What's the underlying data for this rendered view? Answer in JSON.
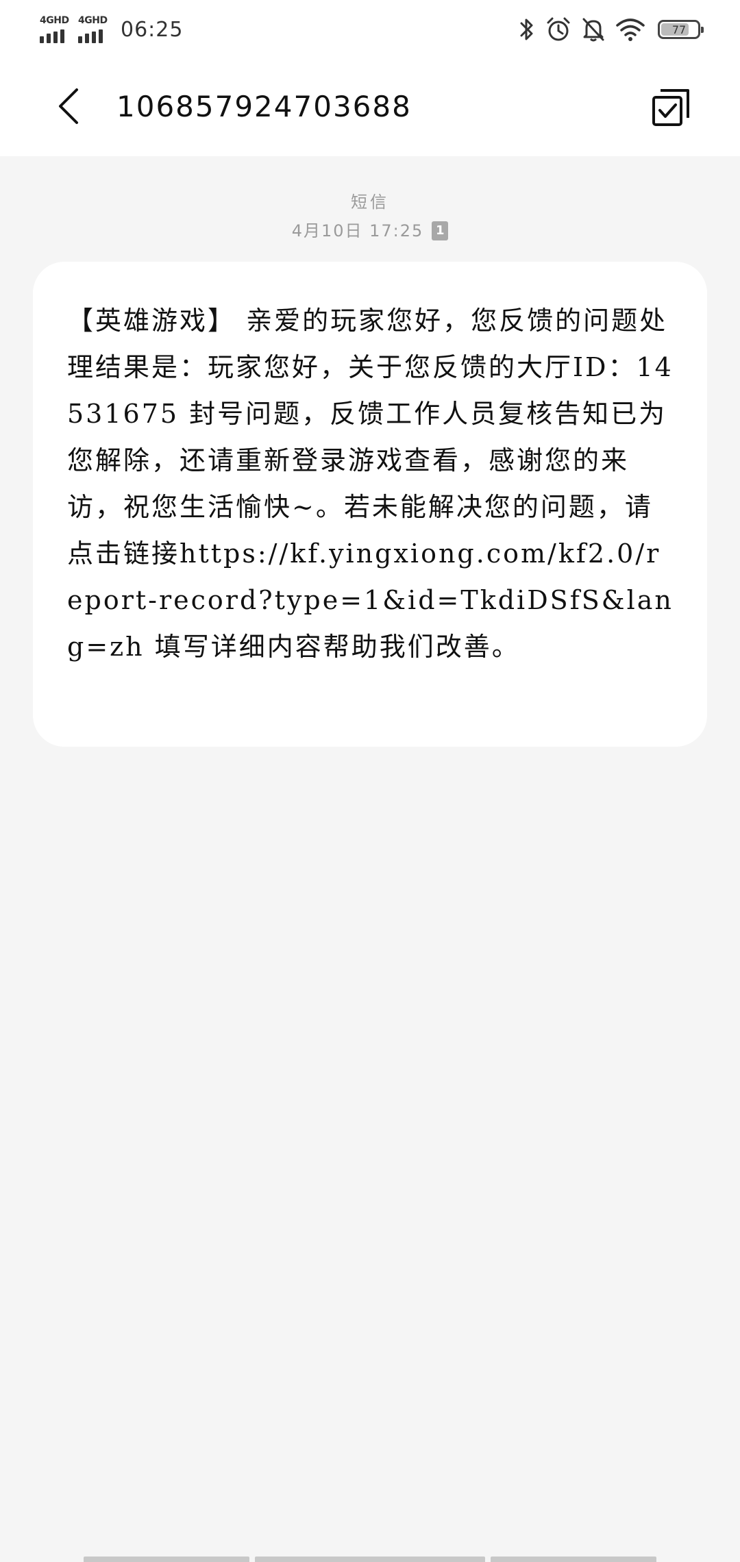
{
  "status_bar": {
    "network_1": "4GHD",
    "network_2": "4GHD",
    "time": "06:25",
    "battery_level": "77",
    "battery_fraction": 0.77,
    "icons": [
      "bluetooth-icon",
      "alarm-icon",
      "mute-icon",
      "wifi-icon",
      "battery-icon"
    ]
  },
  "header": {
    "title": "106857924703688",
    "back_icon": "back-arrow-icon",
    "action_icon": "multi-select-icon"
  },
  "conversation": {
    "type_label": "短信",
    "timestamp": "4月10日 17:25",
    "sim_badge": "1"
  },
  "message": {
    "body": "【英雄游戏】 亲爱的玩家您好，您反馈的问题处理结果是：玩家您好，关于您反馈的大厅ID：14531675 封号问题，反馈工作人员复核告知已为您解除，还请重新登录游戏查看，感谢您的来访，祝您生活愉快~。若未能解决您的问题，请点击链接https://kf.yingxiong.com/kf2.0/report-record?type=1&id=TkdiDSfS&lang=zh 填写详细内容帮助我们改善。"
  },
  "colors": {
    "background": "#f5f5f5",
    "bubble": "#ffffff",
    "header": "#ffffff",
    "meta_text": "#9a9a9a"
  }
}
